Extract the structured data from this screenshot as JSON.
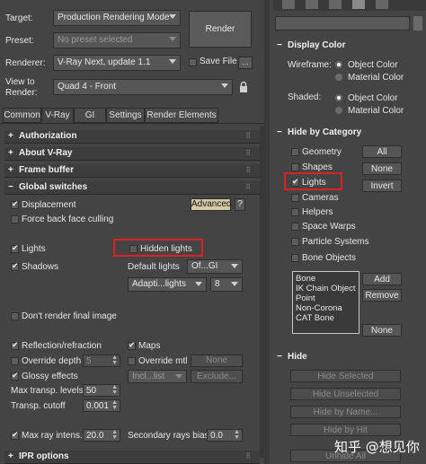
{
  "left": {
    "target_label": "Target:",
    "target_value": "Production Rendering Mode",
    "preset_label": "Preset:",
    "preset_placeholder": "No preset selected",
    "renderer_label": "Renderer:",
    "renderer_value": "V-Ray Next, update 1.1",
    "save_file_label": "Save File",
    "view_label_1": "View to",
    "view_label_2": "Render:",
    "view_value": "Quad 4 - Front",
    "render_button": "Render",
    "tabs": [
      "Common",
      "V-Ray",
      "GI",
      "Settings",
      "Render Elements"
    ],
    "rollouts": {
      "authorization": "Authorization",
      "about": "About V-Ray",
      "frame_buffer": "Frame buffer",
      "global_switches": "Global switches",
      "ipr": "IPR options"
    },
    "gs": {
      "displacement": "Displacement",
      "force_back": "Force back face culling",
      "advanced": "Advanced",
      "help": "?",
      "lights": "Lights",
      "hidden_lights": "Hidden lights",
      "shadows": "Shadows",
      "default_lights_label": "Default lights",
      "default_lights_value": "Of...GI",
      "adaptive_value": "Adapti...lights",
      "adaptive_num": "8",
      "dont_render": "Don't render final image",
      "reflection": "Reflection/refraction",
      "maps": "Maps",
      "override_depth": "Override depth",
      "override_depth_val": "5",
      "override_mtl": "Override mtl",
      "none_btn": "None",
      "glossy": "Glossy effects",
      "incl_list": "Incl...list",
      "exclude": "Exclude...",
      "max_transp_label": "Max transp. levels",
      "max_transp_val": "50",
      "transp_cutoff_label": "Transp. cutoff",
      "transp_cutoff_val": "0.001",
      "max_ray_label": "Max ray intens.",
      "max_ray_val": "20.0",
      "sec_bias_label": "Secondary rays bias",
      "sec_bias_val": "0.0"
    }
  },
  "right": {
    "display_color": {
      "title": "Display Color",
      "wireframe_label": "Wireframe:",
      "shaded_label": "Shaded:",
      "object_color": "Object Color",
      "material_color": "Material Color"
    },
    "hide_by_category": {
      "title": "Hide by Category",
      "items": [
        "Geometry",
        "Shapes",
        "Lights",
        "Cameras",
        "Helpers",
        "Space Warps",
        "Particle Systems",
        "Bone Objects"
      ],
      "all_btn": "All",
      "none_btn": "None",
      "invert_btn": "Invert",
      "list_items": [
        "Bone",
        "IK Chain Object",
        "Point",
        "Non-Corona",
        "CAT Bone"
      ],
      "add_btn": "Add",
      "remove_btn": "Remove",
      "none2_btn": "None"
    },
    "hide": {
      "title": "Hide",
      "buttons": [
        "Hide Selected",
        "Hide Unselected",
        "Hide by Name...",
        "Hide by Hit",
        "Unhide All"
      ]
    }
  },
  "watermark": "知乎 @想见你",
  "colors": {
    "highlight_red": "#e02020",
    "panel_bg": "#444444"
  }
}
